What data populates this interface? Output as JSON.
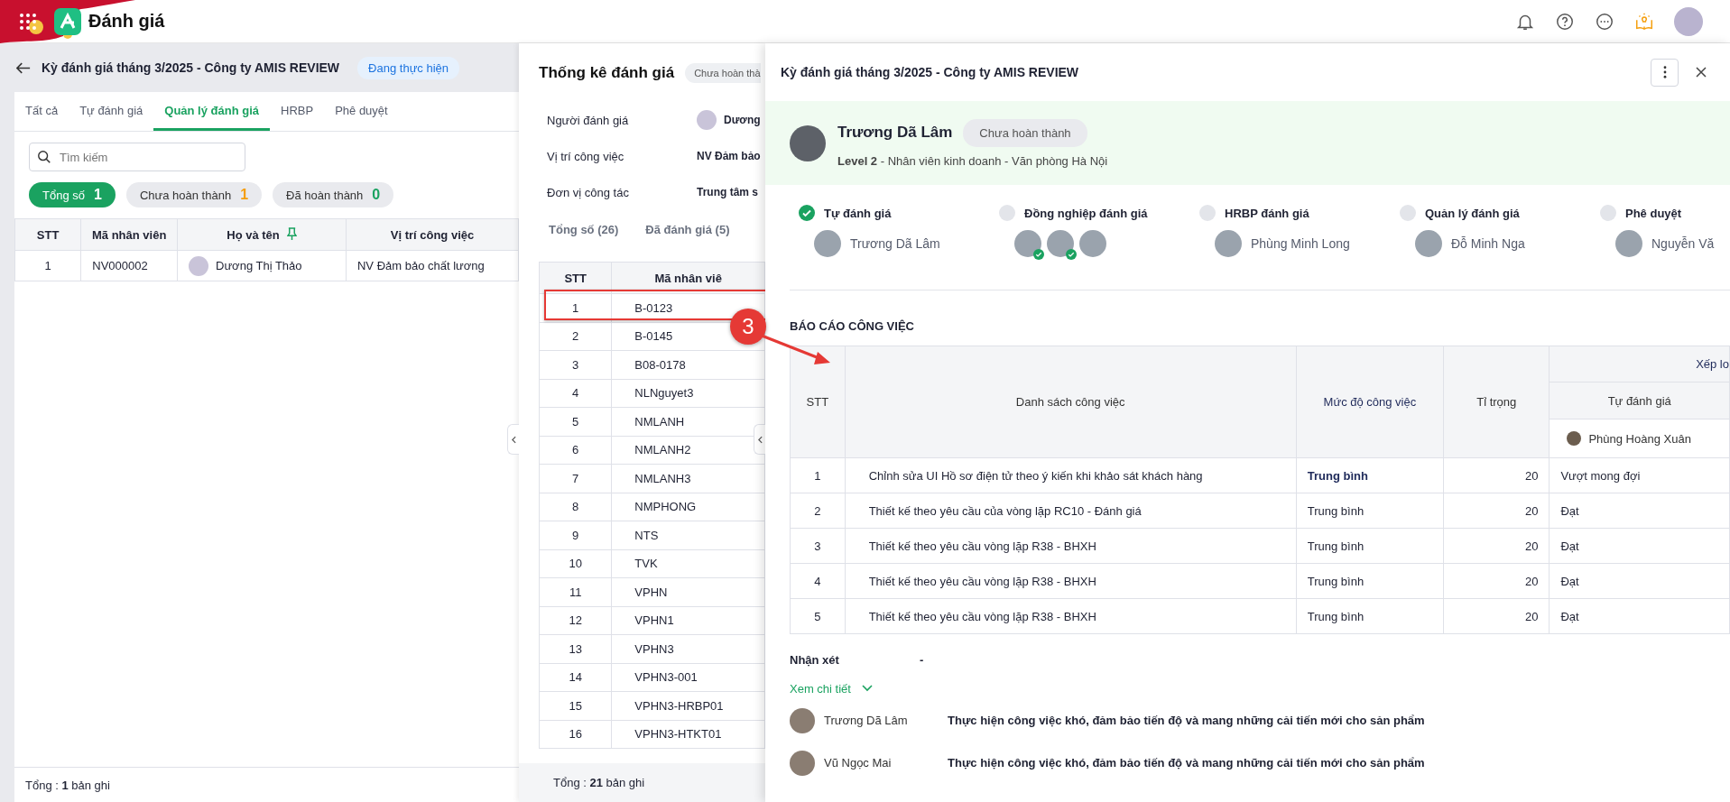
{
  "app": {
    "title": "Đánh giá"
  },
  "left_panel": {
    "title": "Kỳ đánh giá tháng 3/2025 - Công ty AMIS REVIEW",
    "status": "Đang thực hiện",
    "tabs": [
      {
        "label": "Tất cả",
        "selected": false
      },
      {
        "label": "Tự đánh giá",
        "selected": false
      },
      {
        "label": "Quản lý đánh giá",
        "selected": true
      },
      {
        "label": "HRBP",
        "selected": false
      },
      {
        "label": "Phê duyệt",
        "selected": false
      }
    ],
    "search": {
      "placeholder": "Tìm kiếm"
    },
    "chips": [
      {
        "kind": "total",
        "label": "Tổng số",
        "count": "1",
        "selected": true
      },
      {
        "kind": "pending",
        "label": "Chưa hoàn thành",
        "count": "1",
        "selected": false
      },
      {
        "kind": "done",
        "label": "Đã hoàn thành",
        "count": "0",
        "selected": false
      }
    ],
    "table": {
      "columns": [
        {
          "label": "STT",
          "pinned": false
        },
        {
          "label": "Mã nhân viên",
          "pinned": false
        },
        {
          "label": "Họ và tên",
          "pinned": true
        },
        {
          "label": "Vị trí công việc",
          "pinned": false
        }
      ],
      "rows": [
        {
          "stt": "1",
          "code": "NV000002",
          "name": "Dương Thị Thảo",
          "position": "NV Đảm bảo chất lương"
        }
      ]
    },
    "footer": "Tổng : **1** bản ghi"
  },
  "middle_panel": {
    "title": "Thống kê đánh giá",
    "status": "Chưa hoàn thà",
    "info": [
      {
        "kind": "person",
        "label": "Người đánh giá",
        "value": "Dương"
      },
      {
        "kind": "text",
        "label": "Vị trí công việc",
        "value": "NV Đảm bảo"
      },
      {
        "kind": "text",
        "label": "Đơn vị công tác",
        "value": "Trung tâm s"
      }
    ],
    "tabs": [
      {
        "label": "Tổng số (26)",
        "selected": false
      },
      {
        "label": "Đã đánh giá (5)",
        "selected": false
      }
    ],
    "table": {
      "columns": [
        "STT",
        "Mã nhân viê"
      ],
      "rows": [
        {
          "stt": "1",
          "code": "B-0123"
        },
        {
          "stt": "2",
          "code": "B-0145"
        },
        {
          "stt": "3",
          "code": "B08-0178"
        },
        {
          "stt": "4",
          "code": "NLNguyet3"
        },
        {
          "stt": "5",
          "code": "NMLANH"
        },
        {
          "stt": "6",
          "code": "NMLANH2"
        },
        {
          "stt": "7",
          "code": "NMLANH3"
        },
        {
          "stt": "8",
          "code": "NMPHONG"
        },
        {
          "stt": "9",
          "code": "NTS"
        },
        {
          "stt": "10",
          "code": "TVK"
        },
        {
          "stt": "11",
          "code": "VPHN"
        },
        {
          "stt": "12",
          "code": "VPHN1"
        },
        {
          "stt": "13",
          "code": "VPHN3"
        },
        {
          "stt": "14",
          "code": "VPHN3-001"
        },
        {
          "stt": "15",
          "code": "VPHN3-HRBP01"
        },
        {
          "stt": "16",
          "code": "VPHN3-HTKT01"
        }
      ]
    },
    "footer": "Tổng : **21** bản ghi"
  },
  "review_panel": {
    "title": "Kỳ đánh giá tháng 3/2025 - Công ty AMIS REVIEW",
    "employee": {
      "name": "Trương Dã Lâm",
      "status": "Chưa hoàn thành",
      "details": "**Level 2** - Nhân viên kinh doanh - Văn phòng Hà Nội"
    },
    "steps": [
      {
        "label": "Tự đánh giá",
        "done": true,
        "people": [
          {
            "name": "Trương Dã Lâm",
            "checked": false
          }
        ]
      },
      {
        "label": "Đồng nghiệp đánh giá",
        "done": false,
        "people": [
          {
            "checked": true
          },
          {
            "checked": true
          },
          {
            "checked": false
          }
        ]
      },
      {
        "label": "HRBP đánh giá",
        "done": false,
        "people": [
          {
            "name": "Phùng Minh Long",
            "checked": false
          }
        ]
      },
      {
        "label": "Quản lý đánh giá",
        "done": false,
        "people": [
          {
            "name": "Đỗ Minh Nga",
            "checked": false
          }
        ]
      },
      {
        "label": "Phê duyệt",
        "done": false,
        "people": [
          {
            "name": "Nguyễn Vă",
            "checked": false
          }
        ]
      }
    ],
    "report": {
      "title": "BÁO CÁO CÔNG VIỆC",
      "columns": {
        "stt": "STT",
        "task": "Danh sách công việc",
        "level": "Mức độ công việc",
        "weight": "Tỉ trọng",
        "rating_group": "Xếp lo",
        "rating_sub": "Tự đánh giá",
        "rater": "Phùng Hoàng Xuân"
      },
      "rows": [
        {
          "stt": "1",
          "task": "Chỉnh sửa UI Hồ sơ điện tử theo ý kiến khi khảo sát khách hàng",
          "level": "Trung bình",
          "weight": "20",
          "rating": "Vượt mong đợi",
          "highlighted": true
        },
        {
          "stt": "2",
          "task": "Thiết kế theo yêu cầu của vòng lặp RC10 - Đánh giá",
          "level": "Trung bình",
          "weight": "20",
          "rating": "Đạt",
          "highlighted": false
        },
        {
          "stt": "3",
          "task": "Thiết kế theo yêu cầu vòng lặp R38 - BHXH",
          "level": "Trung bình",
          "weight": "20",
          "rating": "Đạt",
          "highlighted": false
        },
        {
          "stt": "4",
          "task": "Thiết kế theo yêu cầu vòng lặp R38 - BHXH",
          "level": "Trung bình",
          "weight": "20",
          "rating": "Đạt",
          "highlighted": false
        },
        {
          "stt": "5",
          "task": "Thiết kế theo yêu cầu vòng lặp R38 - BHXH",
          "level": "Trung bình",
          "weight": "20",
          "rating": "Đạt",
          "highlighted": false
        }
      ]
    },
    "remarks": {
      "label": "Nhận xét",
      "value": "-",
      "toggle": "Xem chi tiết",
      "items": [
        {
          "name": "Trương Dã Lâm",
          "text": "Thực hiện công việc khó, đảm bảo tiến độ và mang những cải tiến mới cho sản phẩm"
        },
        {
          "name": "Vũ Ngọc Mai",
          "text": "Thực hiện công việc khó, đảm bảo tiến độ và mang những cải tiến mới cho sản phẩm"
        }
      ]
    }
  },
  "annotation": {
    "label": "3"
  }
}
